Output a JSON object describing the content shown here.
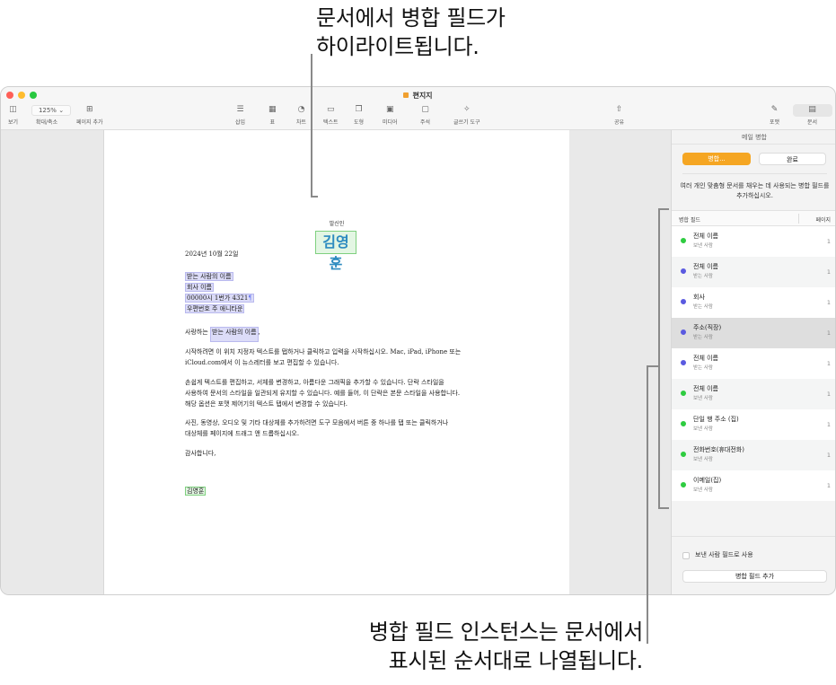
{
  "callouts": {
    "top_line1": "문서에서 병합 필드가",
    "top_line2": "하이라이트됩니다.",
    "bottom_line1": "병합 필드 인스턴스는 문서에서",
    "bottom_line2": "표시된 순서대로 나열됩니다."
  },
  "window": {
    "title": "편지지",
    "traffic_colors": [
      "#fe5f57",
      "#febc2e",
      "#28c840"
    ]
  },
  "toolbar": {
    "view": {
      "label": "보기",
      "icon": "sidebar-icon"
    },
    "zoom": {
      "label": "확대/축소",
      "value": "125%"
    },
    "add_page": {
      "label": "페이지 추가",
      "icon": "plus-square-icon"
    },
    "insert": {
      "label": "삽입",
      "icon": "list-icon"
    },
    "table": {
      "label": "표",
      "icon": "table-icon"
    },
    "chart": {
      "label": "차트",
      "icon": "chart-icon"
    },
    "text": {
      "label": "텍스트",
      "icon": "textbox-icon"
    },
    "shape": {
      "label": "도형",
      "icon": "shape-icon"
    },
    "media": {
      "label": "미디어",
      "icon": "image-icon"
    },
    "comment": {
      "label": "주석",
      "icon": "comment-icon"
    },
    "writing_tools": {
      "label": "글쓰기 도구",
      "icon": "sparkle-icon"
    },
    "share": {
      "label": "공유",
      "icon": "share-icon"
    },
    "format": {
      "label": "포맷",
      "icon": "paintbrush-icon"
    },
    "document": {
      "label": "문서",
      "icon": "document-icon"
    }
  },
  "document": {
    "sender_label": "발신인",
    "sender_name": "김영훈",
    "date": "2024년 10월 22일",
    "recipient_name": "받는 사람의 이름",
    "company_name": "회사 이름",
    "address_line": "00000시 1번가 4321",
    "address_line2": "우편번호 주 애니타운",
    "greeting_prefix": "사랑하는",
    "greeting_field": "받는 사람의 이름",
    "greeting_suffix": ",",
    "para1_line1": "시작하려면 이 위치 지정자 텍스트를 탭하거나 클릭하고 입력을 시작하십시오. Mac, iPad, iPhone 또는",
    "para1_line2": "iCloud.com에서 이 뉴스레터를 보고 편집할 수 있습니다.",
    "para2_line1": "손쉽게 텍스트를 편집하고, 서체를 변경하고, 아름다운 그래픽을 추가할 수 있습니다. 단락 스타일을",
    "para2_line2": "사용하여 문서의 스타일을 일관되게 유지할 수 있습니다. 예를 들어, 이 단락은 본문 스타일을 사용합니다.",
    "para2_line3": "해당 옵션은 포맷 제어기의 텍스트 탭에서 변경할 수 있습니다.",
    "para3_line1": "사진, 동영상, 오디오 및 기타 대상체를 추가하려면 도구 모음에서 버튼 중 하나를 탭 또는 클릭하거나",
    "para3_line2": "대상체를 페이지에 드래그 앤 드롭하십시오.",
    "closing": "감사합니다,",
    "signature": "김영훈"
  },
  "sidebar": {
    "title": "메일 병합",
    "merge_button": "병합...",
    "done_button": "완료",
    "description": "여러 개인 맞춤형 문서를 채우는 데 사용되는 병합 필드를 추가하십시오.",
    "col_field": "병합 필드",
    "col_page": "페이지",
    "fields": [
      {
        "name": "전체 이름",
        "source": "보낸 사람",
        "page": "1",
        "color": "#2ecc40",
        "selected": false
      },
      {
        "name": "전체 이름",
        "source": "받는 사람",
        "page": "1",
        "color": "#5a5ae0",
        "selected": false
      },
      {
        "name": "회사",
        "source": "받는 사람",
        "page": "1",
        "color": "#5a5ae0",
        "selected": false
      },
      {
        "name": "주소(직장)",
        "source": "받는 사람",
        "page": "1",
        "color": "#5a5ae0",
        "selected": true
      },
      {
        "name": "전체 이름",
        "source": "받는 사람",
        "page": "1",
        "color": "#5a5ae0",
        "selected": false
      },
      {
        "name": "전체 이름",
        "source": "보낸 사람",
        "page": "1",
        "color": "#2ecc40",
        "selected": false
      },
      {
        "name": "단일 행 주소 (집)",
        "source": "보낸 사람",
        "page": "1",
        "color": "#2ecc40",
        "selected": false
      },
      {
        "name": "전화번호(휴대전화)",
        "source": "보낸 사람",
        "page": "1",
        "color": "#2ecc40",
        "selected": false
      },
      {
        "name": "이메일(집)",
        "source": "보낸 사람",
        "page": "1",
        "color": "#2ecc40",
        "selected": false
      }
    ],
    "use_sender_checkbox": "보낸 사람 필드로 사용",
    "use_sender_checked": false,
    "add_field_button": "병합 필드 추가"
  }
}
